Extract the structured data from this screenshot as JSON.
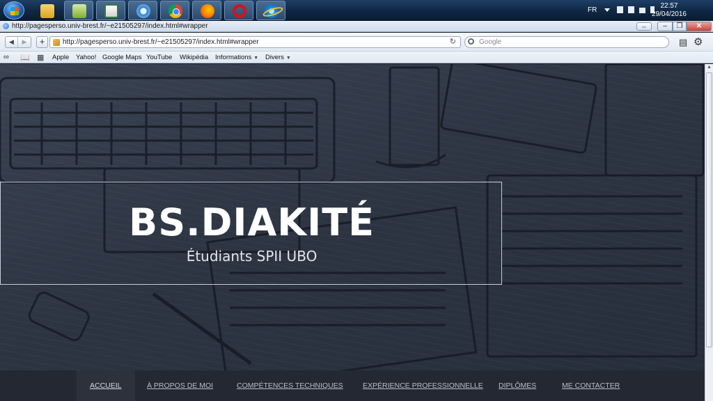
{
  "taskbar": {
    "apps": [
      {
        "name": "explorer",
        "icon": "folder-icon"
      },
      {
        "name": "notepad",
        "icon": "note-icon"
      },
      {
        "name": "excel",
        "icon": "spreadsheet-icon"
      },
      {
        "name": "safari",
        "icon": "safari-icon"
      },
      {
        "name": "chrome",
        "icon": "chrome-icon"
      },
      {
        "name": "firefox",
        "icon": "firefox-icon"
      },
      {
        "name": "opera",
        "icon": "opera-icon"
      },
      {
        "name": "internet-explorer",
        "icon": "ie-icon"
      }
    ],
    "tray": {
      "lang": "FR",
      "time": "22:57",
      "date": "29/04/2016"
    }
  },
  "browser": {
    "window_title": "http://pagesperso.univ-brest.fr/~e21505297/index.html#wrapper",
    "url": "http://pagesperso.univ-brest.fr/~e21505297/index.html#wrapper",
    "search_placeholder": "Google",
    "bookmarks": [
      {
        "label": "Apple"
      },
      {
        "label": "Yahoo!"
      },
      {
        "label": "Google Maps"
      },
      {
        "label": "YouTube"
      },
      {
        "label": "Wikipédia"
      },
      {
        "label": "Informations",
        "menu": true
      },
      {
        "label": "Divers",
        "menu": true
      }
    ]
  },
  "page": {
    "hero": {
      "name": "BS.DIAKITÉ",
      "subtitle": "Étudiants SPII UBO"
    },
    "nav": [
      {
        "label": "ACCUEIL",
        "active": true
      },
      {
        "label": "À PROPOS DE MOI"
      },
      {
        "label": "COMPÉTENCES TECHNIQUES"
      },
      {
        "label": "EXPÉRIENCE PROFESSIONNELLE"
      },
      {
        "label": "DIPLÔMES"
      },
      {
        "label": "ME CONTACTER"
      }
    ]
  },
  "colors": {
    "accent_close": "#c7433a",
    "nav_bg": "#232833",
    "hero_border": "#c9ced6"
  }
}
